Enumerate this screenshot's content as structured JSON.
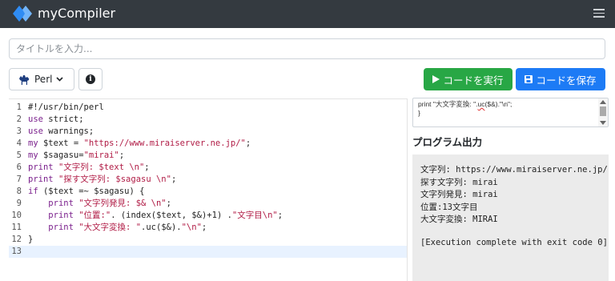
{
  "navbar": {
    "brand": "myCompiler"
  },
  "title_input": {
    "placeholder": "タイトルを入力..."
  },
  "toolbar": {
    "language": "Perl",
    "run_label": "コードを実行",
    "save_label": "コードを保存"
  },
  "editor": {
    "active_line": 13,
    "lines": [
      {
        "num": "1",
        "parts": [
          {
            "t": "#!/usr/bin/perl",
            "c": "plain"
          }
        ]
      },
      {
        "num": "2",
        "parts": [
          {
            "t": "use",
            "c": "kw"
          },
          {
            "t": " strict;",
            "c": "plain"
          }
        ]
      },
      {
        "num": "3",
        "parts": [
          {
            "t": "use",
            "c": "kw"
          },
          {
            "t": " warnings;",
            "c": "plain"
          }
        ]
      },
      {
        "num": "4",
        "parts": [
          {
            "t": "my",
            "c": "kw"
          },
          {
            "t": " $text = ",
            "c": "plain"
          },
          {
            "t": "\"https://www.miraiserver.ne.jp/\"",
            "c": "str"
          },
          {
            "t": ";",
            "c": "plain"
          }
        ]
      },
      {
        "num": "5",
        "parts": [
          {
            "t": "my",
            "c": "kw"
          },
          {
            "t": " $sagasu=",
            "c": "plain"
          },
          {
            "t": "\"mirai\"",
            "c": "str"
          },
          {
            "t": ";",
            "c": "plain"
          }
        ]
      },
      {
        "num": "6",
        "parts": [
          {
            "t": "print",
            "c": "kw"
          },
          {
            "t": " ",
            "c": "plain"
          },
          {
            "t": "\"文字列: $text \\n\"",
            "c": "str"
          },
          {
            "t": ";",
            "c": "plain"
          }
        ]
      },
      {
        "num": "7",
        "parts": [
          {
            "t": "print",
            "c": "kw"
          },
          {
            "t": " ",
            "c": "plain"
          },
          {
            "t": "\"探す文字列: $sagasu \\n\"",
            "c": "str"
          },
          {
            "t": ";",
            "c": "plain"
          }
        ]
      },
      {
        "num": "8",
        "parts": [
          {
            "t": "if",
            "c": "kw"
          },
          {
            "t": " ($text =~ $sagasu) {",
            "c": "plain"
          }
        ]
      },
      {
        "num": "9",
        "parts": [
          {
            "t": "    ",
            "c": "plain"
          },
          {
            "t": "print",
            "c": "kw"
          },
          {
            "t": " ",
            "c": "plain"
          },
          {
            "t": "\"文字列発見: $& \\n\"",
            "c": "str"
          },
          {
            "t": ";",
            "c": "plain"
          }
        ]
      },
      {
        "num": "10",
        "parts": [
          {
            "t": "    ",
            "c": "plain"
          },
          {
            "t": "print",
            "c": "kw"
          },
          {
            "t": " ",
            "c": "plain"
          },
          {
            "t": "\"位置:\"",
            "c": "str"
          },
          {
            "t": ". (index($text, $&)+1) .",
            "c": "plain"
          },
          {
            "t": "\"文字目\\n\"",
            "c": "str"
          },
          {
            "t": ";",
            "c": "plain"
          }
        ]
      },
      {
        "num": "11",
        "parts": [
          {
            "t": "    ",
            "c": "plain"
          },
          {
            "t": "print",
            "c": "kw"
          },
          {
            "t": " ",
            "c": "plain"
          },
          {
            "t": "\"大文字変換: \"",
            "c": "str"
          },
          {
            "t": ".uc($&).",
            "c": "plain"
          },
          {
            "t": "\"\\n\"",
            "c": "str"
          },
          {
            "t": ";",
            "c": "plain"
          }
        ]
      },
      {
        "num": "12",
        "parts": [
          {
            "t": "}",
            "c": "plain"
          }
        ]
      },
      {
        "num": "13",
        "parts": []
      }
    ]
  },
  "input_panel": {
    "line1_pre": "print \"大文字変換: \".",
    "line1_sq": "uc",
    "line1_post": "($&).\"\\n\";",
    "line2": "}"
  },
  "output": {
    "title": "プログラム出力",
    "lines": [
      "文字列: https://www.miraiserver.ne.jp/",
      "探す文字列: mirai",
      "文字列発見: mirai",
      "位置:13文字目",
      "大文字変換: MIRAI",
      "",
      "[Execution complete with exit code 0]"
    ]
  },
  "colors": {
    "navbar": "#343a40",
    "run": "#28a745",
    "save": "#1d7bf5",
    "keyword": "#7a1f8c",
    "string": "#b01b45"
  }
}
